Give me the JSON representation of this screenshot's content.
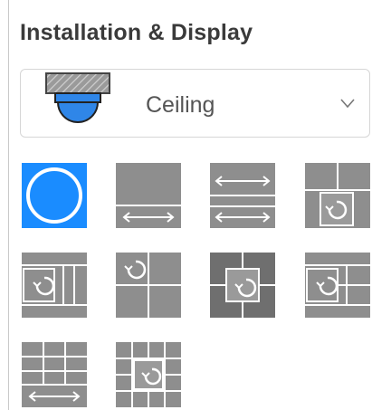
{
  "panel": {
    "title": "Installation & Display"
  },
  "mount": {
    "selected": "Ceiling",
    "icon": "ceiling-camera-icon",
    "chevron": "chevron-down-icon"
  },
  "colors": {
    "selected": "#1a8cff",
    "tile": "#8e8e8e",
    "tile_dark": "#6f6f6f",
    "lines": "#ffffff"
  },
  "display_modes": [
    {
      "icon": "fisheye-circle-icon",
      "selected": true
    },
    {
      "icon": "panorama-single-icon",
      "selected": false
    },
    {
      "icon": "panorama-dual-icon",
      "selected": false
    },
    {
      "icon": "fisheye-plus-three-icon",
      "selected": false
    },
    {
      "icon": "fisheye-plus-three-vertical-icon",
      "selected": false
    },
    {
      "icon": "fisheye-plus-three-quad-icon",
      "selected": false
    },
    {
      "icon": "fisheye-center-four-icon",
      "selected": false
    },
    {
      "icon": "fisheye-plus-six-icon",
      "selected": false
    },
    {
      "icon": "panorama-plus-eight-icon",
      "selected": false
    },
    {
      "icon": "fisheye-center-eight-icon",
      "selected": false
    }
  ]
}
